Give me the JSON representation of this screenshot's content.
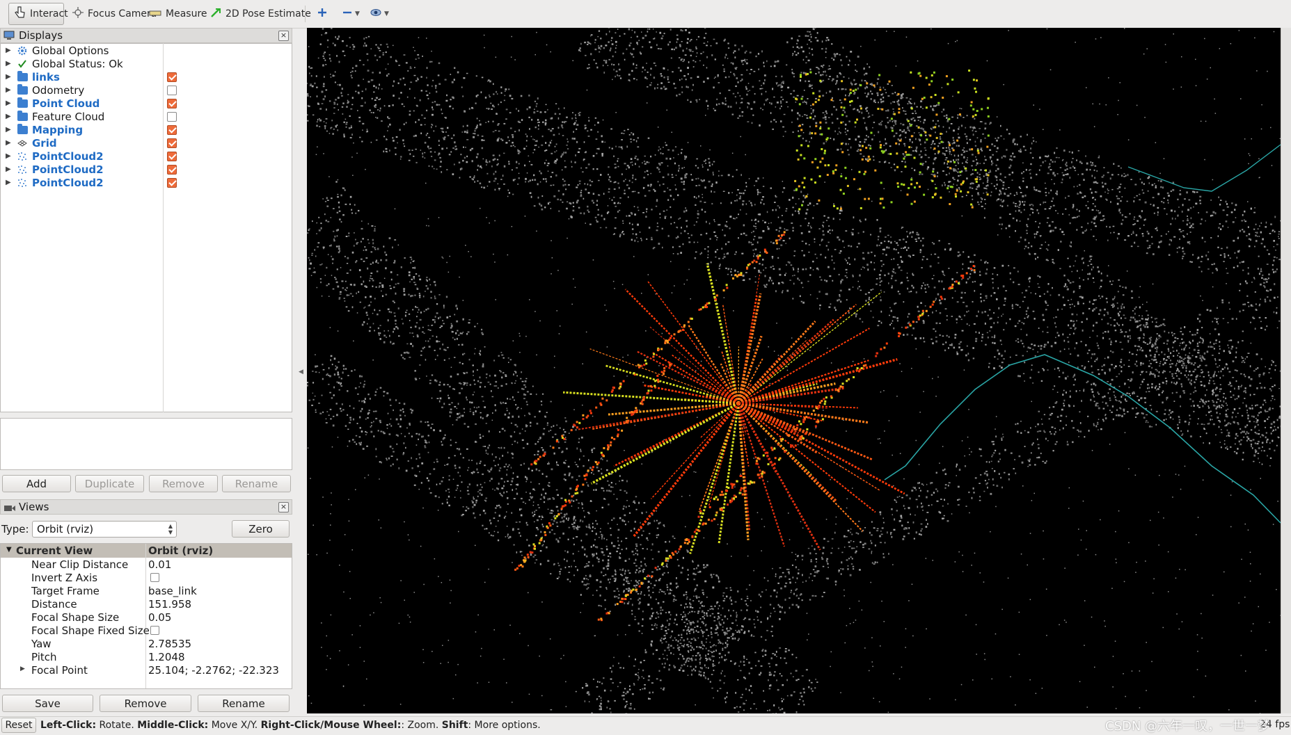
{
  "toolbar": {
    "tools": [
      {
        "label": "Interact",
        "icon": "hand-pointer-icon",
        "active": true
      },
      {
        "label": "Focus Camera",
        "icon": "crosshair-icon"
      },
      {
        "label": "Measure",
        "icon": "ruler-icon"
      },
      {
        "label": "2D Pose Estimate",
        "icon": "green-arrow-icon"
      }
    ],
    "extra_icons": [
      "add-tool-icon",
      "remove-tool-icon",
      "camera-view-icon"
    ]
  },
  "displays_panel": {
    "title": "Displays",
    "items": [
      {
        "label": "Global Options",
        "icon": "gear-icon",
        "highlight": false,
        "has_check": false
      },
      {
        "label": "Global Status: Ok",
        "icon": "status-ok-check-icon",
        "highlight": false,
        "has_check": false
      },
      {
        "label": "links",
        "icon": "folder-icon",
        "highlight": true,
        "has_check": true,
        "checked": true
      },
      {
        "label": "Odometry",
        "icon": "folder-icon",
        "highlight": false,
        "has_check": true,
        "checked": false
      },
      {
        "label": "Point Cloud",
        "icon": "folder-icon",
        "highlight": true,
        "has_check": true,
        "checked": true
      },
      {
        "label": "Feature Cloud",
        "icon": "folder-icon",
        "highlight": false,
        "has_check": true,
        "checked": false
      },
      {
        "label": "Mapping",
        "icon": "folder-icon",
        "highlight": true,
        "has_check": true,
        "checked": true
      },
      {
        "label": "Grid",
        "icon": "grid-icon",
        "highlight": true,
        "has_check": true,
        "checked": true
      },
      {
        "label": "PointCloud2",
        "icon": "pointcloud-icon",
        "highlight": true,
        "has_check": true,
        "checked": true
      },
      {
        "label": "PointCloud2",
        "icon": "pointcloud-icon",
        "highlight": true,
        "has_check": true,
        "checked": true
      },
      {
        "label": "PointCloud2",
        "icon": "pointcloud-icon",
        "highlight": true,
        "has_check": true,
        "checked": true
      }
    ],
    "buttons": {
      "add": "Add",
      "duplicate": "Duplicate",
      "remove": "Remove",
      "rename": "Rename"
    }
  },
  "views_panel": {
    "title": "Views",
    "type_label": "Type:",
    "type_value": "Orbit (rviz)",
    "zero_label": "Zero",
    "header": {
      "name": "Current View",
      "value": "Orbit (rviz)"
    },
    "properties": [
      {
        "key": "Near Clip Distance",
        "value": "0.01"
      },
      {
        "key": "Invert Z Axis",
        "value": "",
        "checkbox": true
      },
      {
        "key": "Target Frame",
        "value": "base_link"
      },
      {
        "key": "Distance",
        "value": "151.958"
      },
      {
        "key": "Focal Shape Size",
        "value": "0.05"
      },
      {
        "key": "Focal Shape Fixed Size",
        "value": "",
        "checkbox": true
      },
      {
        "key": "Yaw",
        "value": "2.78535"
      },
      {
        "key": "Pitch",
        "value": "1.2048"
      },
      {
        "key": "Focal Point",
        "value": "25.104; -2.2762; -22.323",
        "expandable": true
      }
    ],
    "buttons": {
      "save": "Save",
      "remove": "Remove",
      "rename": "Rename"
    }
  },
  "statusbar": {
    "reset": "Reset",
    "hint_parts": [
      {
        "bold": "Left-Click:",
        "text": " Rotate. "
      },
      {
        "bold": "Middle-Click:",
        "text": " Move X/Y. "
      },
      {
        "bold": "Right-Click/Mouse Wheel:",
        "text": ": Zoom. "
      },
      {
        "bold": "Shift",
        "text": ": More options."
      }
    ],
    "fps": "24 fps"
  },
  "watermark": "CSDN @六年一叹，一世一梦",
  "colors": {
    "accent_check": "#ee6b3a",
    "highlight_text": "#1f6bc4",
    "viewport_bg": "#000000",
    "point_gray": "#8c8c8c",
    "scan_orange": "#ff5a14",
    "path_cyan": "#2aa6a6"
  }
}
